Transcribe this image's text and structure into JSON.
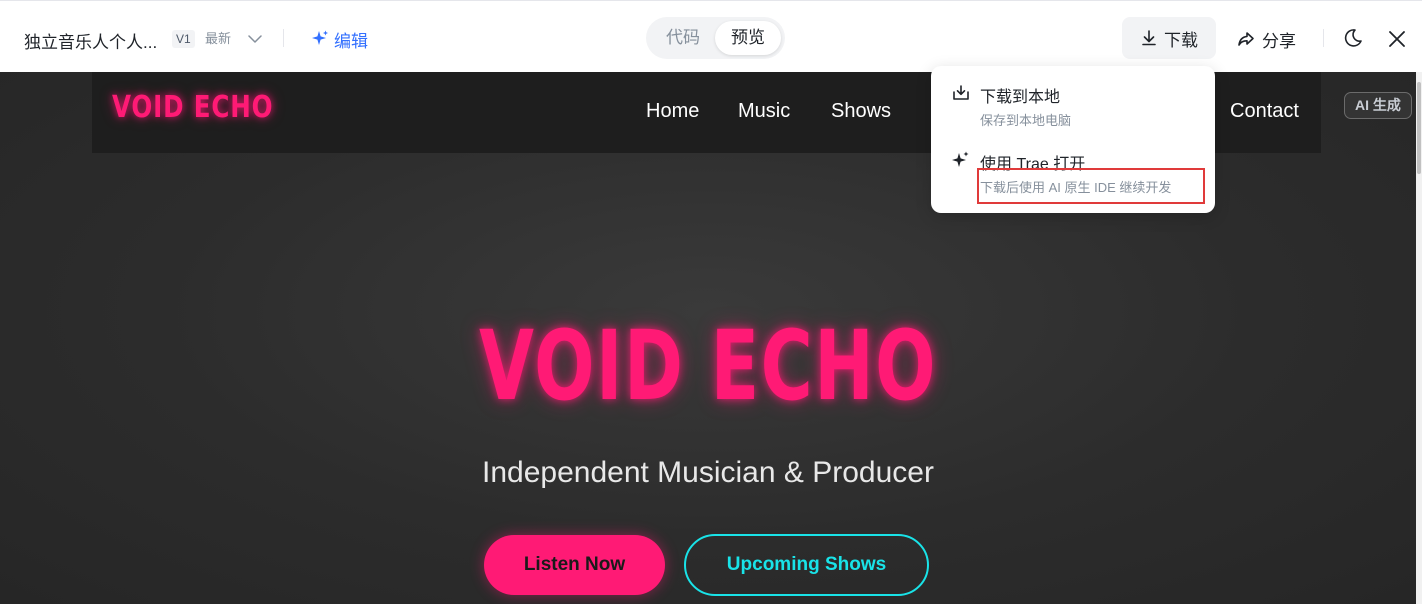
{
  "toolbar": {
    "doc_title": "独立音乐人个人...",
    "version": "V1",
    "version_status": "最新",
    "edit_label": "编辑",
    "view_tabs": {
      "code": "代码",
      "preview": "预览"
    },
    "active_tab": "预览",
    "download_label": "下载",
    "share_label": "分享",
    "accent_color": "#3370ff"
  },
  "download_menu": {
    "items": [
      {
        "title": "下载到本地",
        "description": "保存到本地电脑",
        "icon": "download-tray-icon"
      },
      {
        "title": "使用 Trae 打开",
        "description": "下载后使用 AI 原生 IDE 继续开发",
        "icon": "sparkle-icon"
      }
    ],
    "highlight_color": "#e03a3a"
  },
  "site": {
    "logo": "VOID ECHO",
    "nav": [
      "Home",
      "Music",
      "Shows",
      "Contact"
    ],
    "ai_badge": "AI 生成",
    "hero": {
      "title": "VOID ECHO",
      "subtitle": "Independent Musician & Producer",
      "primary_button": "Listen Now",
      "secondary_button": "Upcoming Shows"
    },
    "colors": {
      "brand_pink": "#ff1a75",
      "accent_cyan": "#19e3e8",
      "background": "#2c2c2c"
    }
  }
}
